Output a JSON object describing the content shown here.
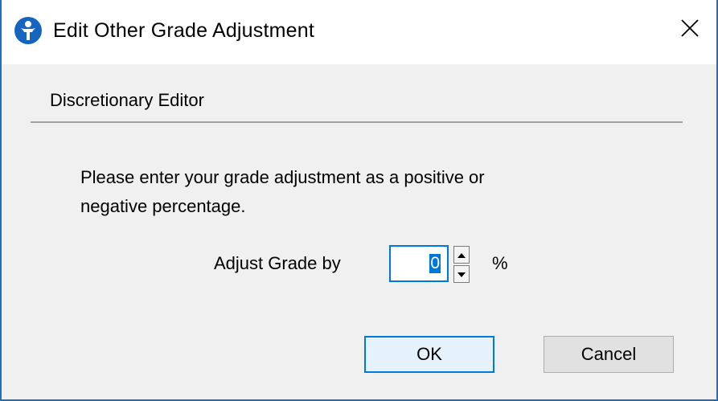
{
  "window": {
    "title": "Edit Other Grade Adjustment",
    "app_icon": "person-circle-icon",
    "close_icon": "close-icon"
  },
  "dialog": {
    "section_header": "Discretionary Editor",
    "instructions_line1": "Please enter your grade adjustment as a positive or",
    "instructions_line2": "negative percentage.",
    "adjust_label": "Adjust Grade by",
    "adjust_value": "0",
    "unit": "%",
    "ok_label": "OK",
    "cancel_label": "Cancel"
  },
  "colors": {
    "accent": "#0078d7",
    "window_border": "#1e6fc0",
    "dialog_bg": "#f0f0f0"
  }
}
